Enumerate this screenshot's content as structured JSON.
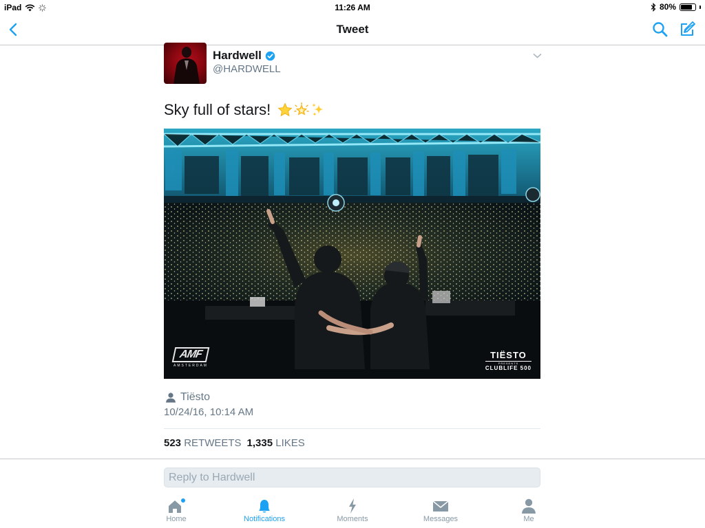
{
  "status_bar": {
    "device": "iPad",
    "time": "11:26 AM",
    "battery": "80%",
    "battery_level": 0.8
  },
  "nav": {
    "title": "Tweet",
    "back_icon": "chevron-left-icon",
    "search_icon": "search-icon",
    "compose_icon": "compose-icon"
  },
  "tweet": {
    "author_name": "Hardwell",
    "author_handle": "@HARDWELL",
    "verified": true,
    "text": "Sky full of stars!",
    "emojis": [
      "star",
      "glowing-star",
      "sparkles"
    ],
    "photo": {
      "logo_left": "AMF",
      "logo_left_sub": "AMSTERDAM",
      "logo_right": "TIËSTO",
      "logo_right_sub1": "PRESENTS",
      "logo_right_sub2": "CLUBLIFE 500"
    },
    "retweeted_by": "Tiësto",
    "timestamp": "10/24/16, 10:14 AM",
    "retweets_count": "523",
    "retweets_label": "RETWEETS",
    "likes_count": "1,335",
    "likes_label": "LIKES"
  },
  "reply": {
    "placeholder": "Reply to Hardwell"
  },
  "tab_bar": {
    "tabs": [
      {
        "label": "Home",
        "icon": "home-icon",
        "active": false
      },
      {
        "label": "Notifications",
        "icon": "bell-icon",
        "active": true
      },
      {
        "label": "Moments",
        "icon": "lightning-icon",
        "active": false
      },
      {
        "label": "Messages",
        "icon": "envelope-icon",
        "active": false
      },
      {
        "label": "Me",
        "icon": "person-icon",
        "active": false
      }
    ]
  },
  "colors": {
    "accent": "#1da1f2",
    "text_secondary": "#657786",
    "tab_inactive": "#8899a6"
  }
}
